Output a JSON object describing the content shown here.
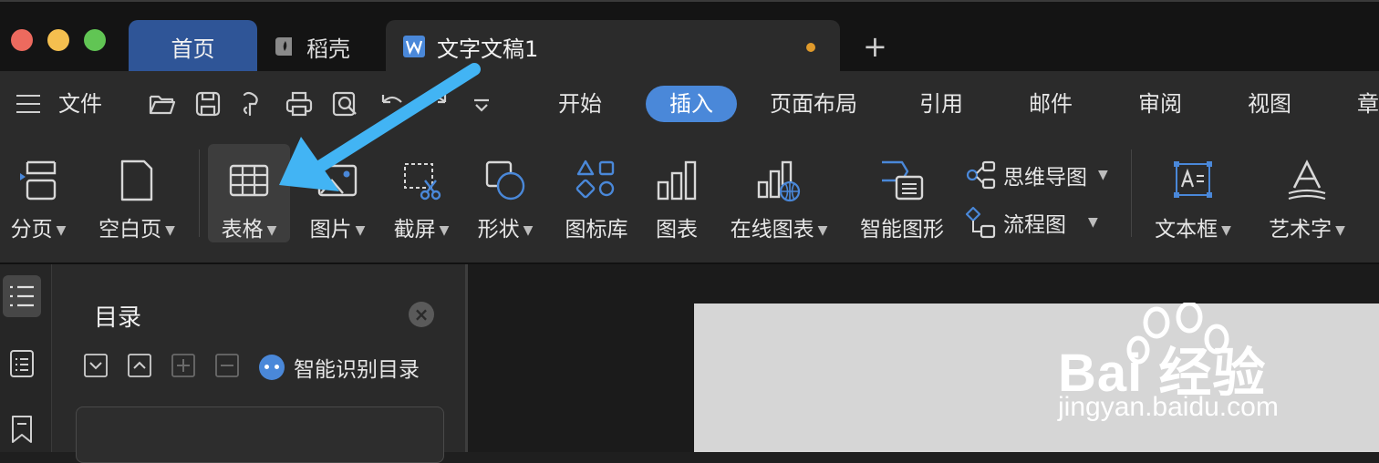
{
  "colors": {
    "accent": "#4a88d9",
    "home_tab": "#2f5597",
    "light_red": "#ed6a5e",
    "light_yellow": "#f4bf4f",
    "light_green": "#61c554",
    "unsaved_dot": "#e09a2b",
    "arrow": "#42b4f4"
  },
  "tabs": {
    "home": "首页",
    "daoke": "稻壳",
    "doc": "文字文稿1"
  },
  "menu": {
    "file": "文件",
    "items": [
      "开始",
      "插入",
      "页面布局",
      "引用",
      "邮件",
      "审阅",
      "视图",
      "章"
    ],
    "active": "插入"
  },
  "quick_access_icons": [
    "open-folder-icon",
    "save-icon",
    "format-painter-icon",
    "print-icon",
    "print-preview-icon",
    "undo-icon",
    "redo-icon",
    "more-dropdown-icon"
  ],
  "ribbon": {
    "page_break": "分页",
    "blank_page": "空白页",
    "table": "表格",
    "picture": "图片",
    "screenshot": "截屏",
    "shape": "形状",
    "icon_library": "图标库",
    "chart": "图表",
    "online_chart": "在线图表",
    "smart_graphic": "智能图形",
    "mind_map": "思维导图",
    "flowchart": "流程图",
    "text_box": "文本框",
    "word_art": "艺术字"
  },
  "toc": {
    "title": "目录",
    "smart_label": "智能识别目录"
  },
  "watermark": {
    "brand": "Bai   经验",
    "url": "jingyan.baidu.com"
  }
}
